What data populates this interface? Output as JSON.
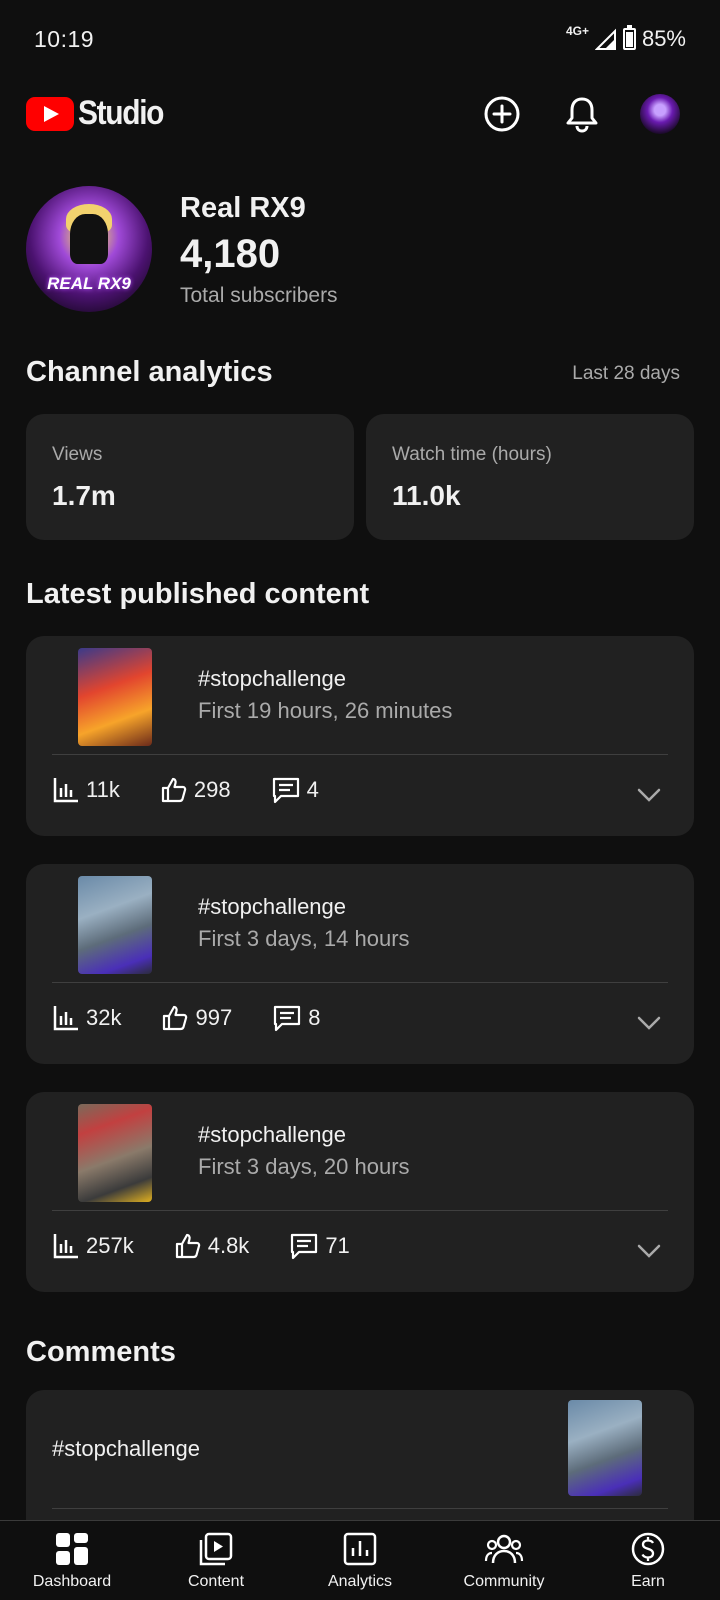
{
  "status_bar": {
    "time": "10:19",
    "network": "4G+",
    "battery": "85%",
    "battery_level": 0.85
  },
  "header": {
    "app_name": "Studio"
  },
  "channel": {
    "name": "Real RX9",
    "avatar_text": "REAL RX9",
    "subscribers": "4,180",
    "subscribers_label": "Total subscribers"
  },
  "analytics": {
    "title": "Channel analytics",
    "range": "Last 28 days",
    "views": {
      "label": "Views",
      "value": "1.7m"
    },
    "watch_time": {
      "label": "Watch time (hours)",
      "value": "11.0k"
    }
  },
  "latest": {
    "title": "Latest published content",
    "items": [
      {
        "title": "#stopchallenge",
        "subtitle": "First 19 hours, 26 minutes",
        "views": "11k",
        "likes": "298",
        "comments": "4"
      },
      {
        "title": "#stopchallenge",
        "subtitle": "First 3 days, 14 hours",
        "views": "32k",
        "likes": "997",
        "comments": "8"
      },
      {
        "title": "#stopchallenge",
        "subtitle": "First 3 days, 20 hours",
        "views": "257k",
        "likes": "4.8k",
        "comments": "71"
      }
    ]
  },
  "comments": {
    "title": "Comments",
    "item_title": "#stopchallenge"
  },
  "nav": [
    {
      "label": "Dashboard",
      "icon": "dashboard-icon"
    },
    {
      "label": "Content",
      "icon": "content-icon"
    },
    {
      "label": "Analytics",
      "icon": "analytics-icon"
    },
    {
      "label": "Community",
      "icon": "community-icon"
    },
    {
      "label": "Earn",
      "icon": "earn-icon"
    }
  ],
  "colors": {
    "background": "#0f0f0f",
    "card": "#212121",
    "brand_red": "#ff0000",
    "muted_text": "#aaaaaa"
  }
}
